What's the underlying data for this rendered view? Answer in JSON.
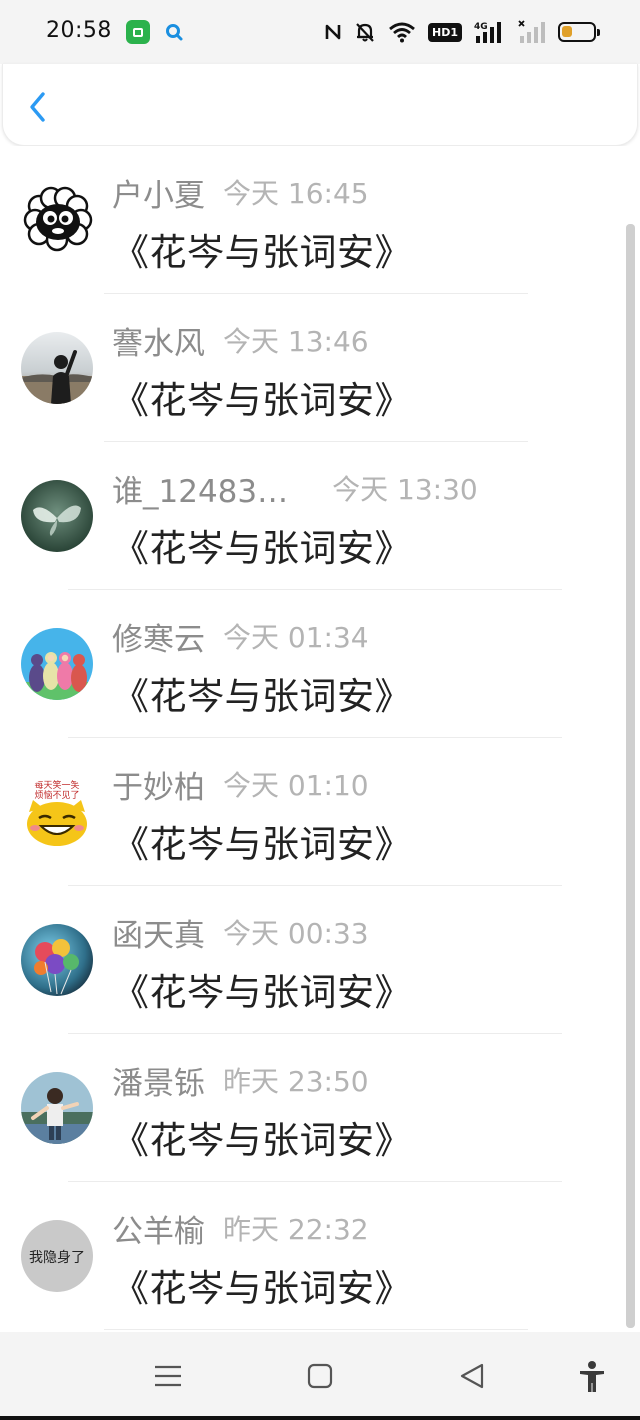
{
  "status_bar": {
    "time": "20:58",
    "hd_label": "HD1",
    "network_label": "4G",
    "battery_level": 0.35,
    "battery_color": "#e0a02a",
    "app_icon_color": "#2bb24c",
    "left_icons": [
      "app-icon",
      "search-icon"
    ],
    "right_icons": [
      "nfc-icon",
      "bell-off-icon",
      "wifi-icon",
      "hd-icon",
      "signal-4g-icon",
      "signal-no-sim-icon",
      "battery-icon"
    ]
  },
  "header": {
    "back_icon": "chevron-left-icon",
    "accent_color": "#2b9af3"
  },
  "book_title": "《花岑与张词安》",
  "items": [
    {
      "name": "户小夏",
      "time": "今天 16:45",
      "avatar": "sheep-avatar"
    },
    {
      "name": "謇水风",
      "time": "今天 13:46",
      "avatar": "girl-waving-avatar"
    },
    {
      "name": "谁_12483…",
      "time": "今天 13:30",
      "avatar": "green-butterfly-avatar"
    },
    {
      "name": "修寒云",
      "time": "今天 01:34",
      "avatar": "teletubbies-avatar"
    },
    {
      "name": "于妙柏",
      "time": "今天 01:10",
      "avatar": "smiling-cat-avatar"
    },
    {
      "name": "函天真",
      "time": "今天 00:33",
      "avatar": "balloons-avatar"
    },
    {
      "name": "潘景铄",
      "time": "昨天 23:50",
      "avatar": "boy-photo-avatar"
    },
    {
      "name": "公羊榆",
      "time": "昨天 22:32",
      "avatar": "hidden-user-avatar"
    }
  ],
  "avatar_texts": {
    "cat_line1": "每天笑一笑",
    "cat_line2": "烦恼不见了",
    "hidden": "我隐身了"
  },
  "nav_bar": {
    "icons": [
      "menu-icon",
      "home-square-icon",
      "back-triangle-icon",
      "accessibility-icon"
    ]
  }
}
